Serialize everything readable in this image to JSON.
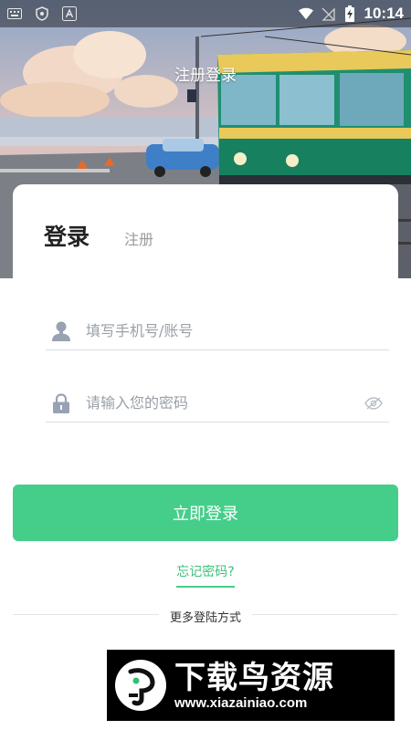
{
  "status_bar": {
    "time": "10:14",
    "left_icons": [
      "keyboard-icon",
      "shield-icon",
      "a-badge-icon"
    ],
    "right_icons": [
      "wifi-icon",
      "no-sim-icon",
      "battery-charging-icon"
    ]
  },
  "header": {
    "title": "注册登录",
    "background": "anime-style-tram-seaside-illustration"
  },
  "tabs": {
    "login": "登录",
    "register": "注册"
  },
  "form": {
    "account_placeholder": "填写手机号/账号",
    "account_value": "",
    "password_placeholder": "请输入您的密码",
    "password_value": "",
    "user_icon": "user-icon",
    "lock_icon": "lock-icon",
    "visibility_icon": "eye-off-icon"
  },
  "actions": {
    "login_button": "立即登录",
    "forgot_password": "忘记密码?",
    "more_methods": "更多登陆方式"
  },
  "watermark": {
    "title": "下载鸟资源",
    "url": "www.xiazainiao.com"
  },
  "colors": {
    "accent": "#45ce8a",
    "link": "#3dbf7d",
    "placeholder": "#9aa0a8",
    "icon": "#98a2b3"
  }
}
